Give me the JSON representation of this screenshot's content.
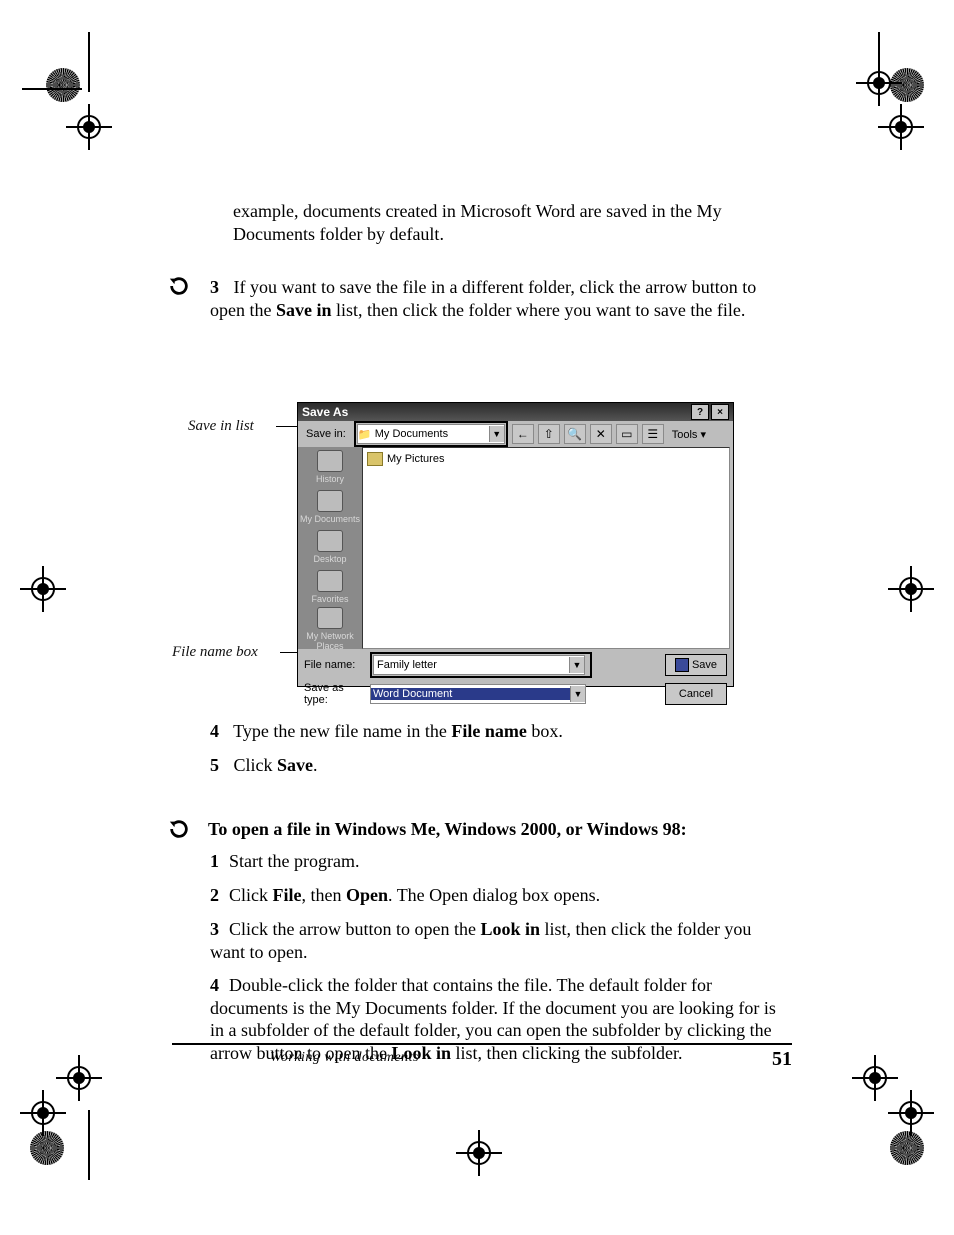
{
  "callouts": {
    "save_in_list": "Save in list",
    "file_name_box": "File name box"
  },
  "intro_line": "example, documents created in Microsoft Word are saved in the My Documents folder by default.",
  "step3": {
    "bullet": "3",
    "text": "  If you want to save the file in a different folder, click the arrow button to open the <b>Save in</b> list, then click the folder where you want to save the file."
  },
  "dialog": {
    "title": "Save As",
    "help_btn": "?",
    "close_btn": "×",
    "save_in_label": "Save in:",
    "save_in_value": "My Documents",
    "toolbar_icons": [
      "←",
      "⇧",
      "🔍",
      "✕",
      "▭",
      "☰"
    ],
    "tools_label": "Tools ▾",
    "places": [
      "History",
      "My Documents",
      "Desktop",
      "Favorites",
      "My Network Places"
    ],
    "file_item": "My Pictures",
    "file_name_label": "File name:",
    "file_name_value": "Family letter",
    "save_as_type_label": "Save as type:",
    "save_as_type_value": "Word Document",
    "save_btn": "Save",
    "cancel_btn": "Cancel"
  },
  "step4": {
    "bullet": "4",
    "text": "  Type the new file name in the <b>File name</b> box."
  },
  "step5": {
    "bullet": "5",
    "text": "  Click <b>Save</b>."
  },
  "section": {
    "heading": "To open a file in Windows Me, Windows 2000, or Windows 98:",
    "s1": "Start the program.",
    "s2_a": "Click ",
    "s2_b": "File",
    "s2_c": ", then ",
    "s2_d": "Open",
    "s2_e": ". The Open dialog box opens.",
    "s3_a": "Click the arrow button to open the ",
    "s3_b": "Look in",
    "s3_c": " list, then click the folder you want to open.",
    "s4_a": "Double-click the folder that contains the file. The default folder for documents is the My Documents folder. If the document you are looking for is in a subfolder of the default folder, you can open the subfolder by clicking the arrow button to open the ",
    "s4_b": "Look in",
    "s4_c": " list, then clicking the subfolder."
  },
  "footer": {
    "running": "Working with documents",
    "page": "51"
  }
}
